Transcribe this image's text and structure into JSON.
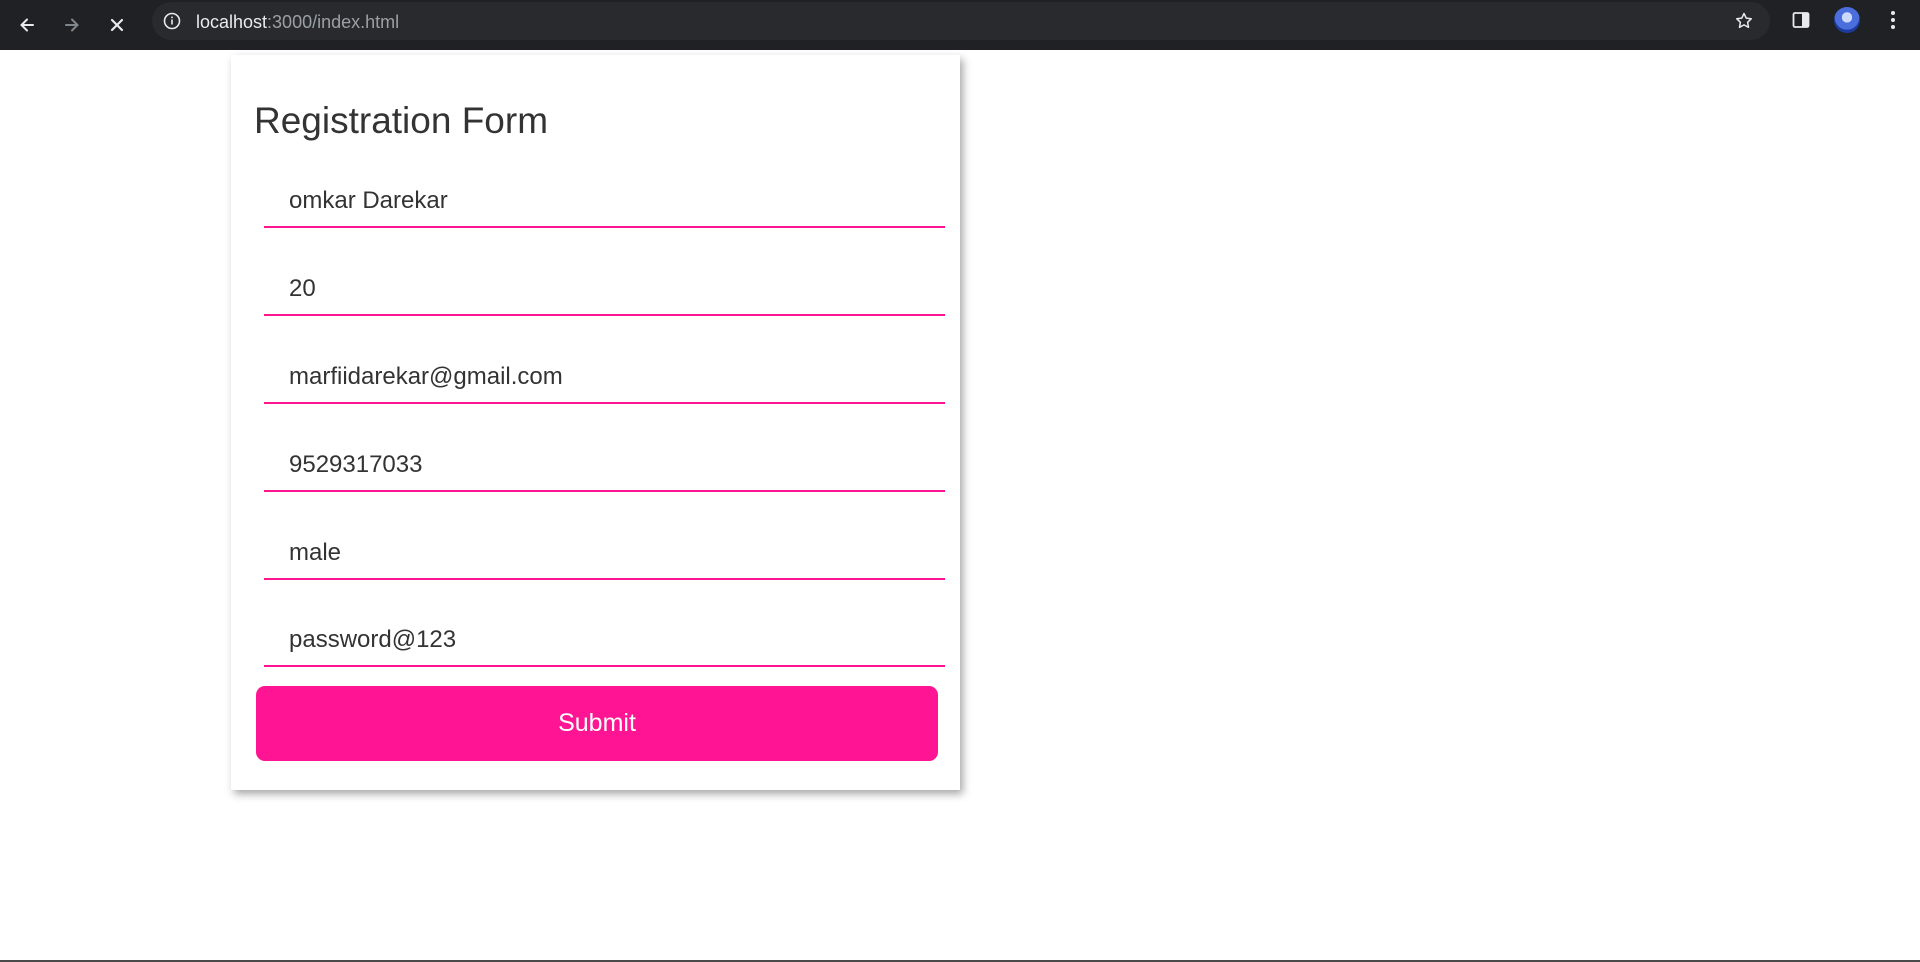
{
  "browser": {
    "url_host": "localhost",
    "url_rest": ":3000/index.html",
    "icons": [
      "back-arrow-icon",
      "forward-arrow-icon",
      "stop-loading-icon",
      "site-info-icon",
      "bookmark-star-icon",
      "side-panel-icon",
      "profile-avatar",
      "menu-dots-icon"
    ]
  },
  "form": {
    "title": "Registration Form",
    "fields": {
      "name": "omkar Darekar",
      "age": "20",
      "email": "marfiidarekar@gmail.com",
      "phone": "9529317033",
      "gender": "male",
      "password": "password@123"
    },
    "submit_label": "Submit"
  },
  "colors": {
    "accent": "#ff1493",
    "text": "#333333",
    "browser_bg": "#202124"
  }
}
